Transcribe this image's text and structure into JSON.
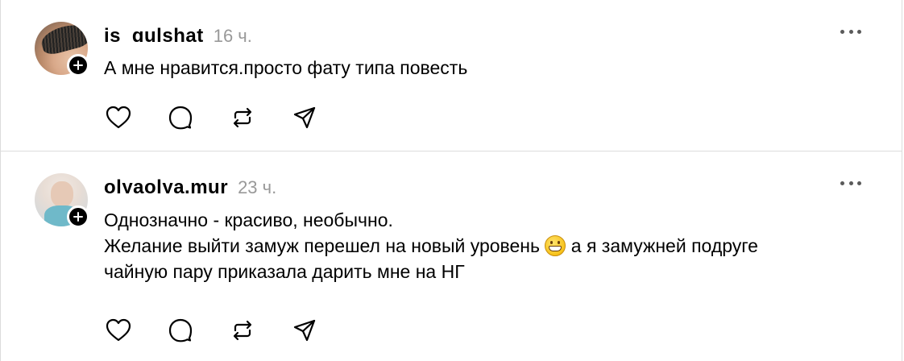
{
  "comments": [
    {
      "username": "is_gulshat",
      "timestamp": "16 ч.",
      "text_lines": [
        "А мне нравится.просто фату типа повесть"
      ]
    },
    {
      "username": "olyaolya.mur",
      "timestamp": "23 ч.",
      "text_lines": [
        "Однозначно - красиво, необычно.",
        "Желание выйти замуж перешел на новый уровень",
        "а я замужней подруге",
        "чайную пару приказала дарить мне на НГ"
      ],
      "emoji": "grimacing-face"
    }
  ],
  "icons": {
    "like": "heart-icon",
    "comment": "speech-bubble-icon",
    "repost": "repost-icon",
    "share": "send-icon",
    "more": "more-dots-icon",
    "follow": "plus-icon"
  }
}
